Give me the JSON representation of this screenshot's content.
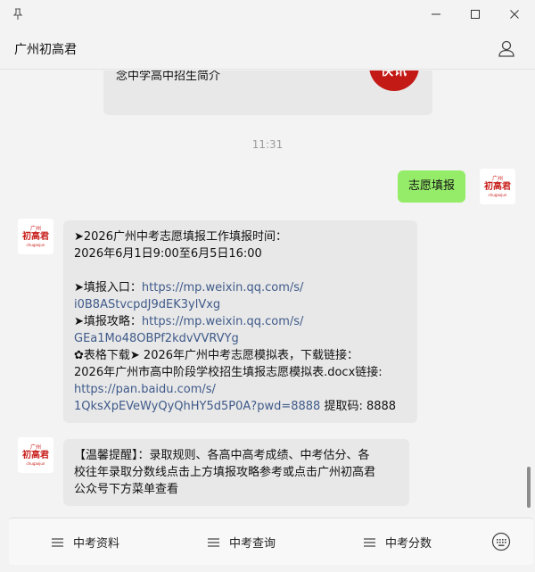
{
  "window": {
    "title": "广州初高君"
  },
  "conversation": {
    "article_card": {
      "text": "念中学高中招生简介",
      "thumb_text": "快讯"
    },
    "timestamp": "11:31",
    "sent_message": "志愿填报",
    "avatar": {
      "top": "广州",
      "main": "初高君",
      "sub": "chugaojun"
    },
    "reply1": {
      "line1": "➤2026广州中考志愿填报工作填报时间：",
      "line2": "2026年6月1日9:00至6月5日16:00",
      "entry_label": "➤填报入口：",
      "entry_url_part1": "https://mp.weixin.qq.com/s/",
      "entry_url_part2": "i0B8AStvcpdJ9dEK3ylVxg",
      "guide_label": "➤填报攻略：",
      "guide_url_part1": "https://mp.weixin.qq.com/s/",
      "guide_url_part2": "GEa1Mo48OBPf2kdvVVRVYg",
      "download_line": "✿表格下载➤ 2026年广州中考志愿模拟表，下载链接：",
      "file_line": "2026年广州市高中阶段学校招生填报志愿模拟表.docx链接:",
      "pan_url_part1": "https://pan.baidu.com/s/",
      "pan_url_part2": "1QksXpEVeWyQyQhHY5d5P0A?pwd=8888",
      "code_text": " 提取码: 8888"
    },
    "reply2": {
      "line1": "【温馨提醒】：录取规则、各高中高考成绩、中考估分、各",
      "line2": "校往年录取分数线点击上方填报攻略参考或点击广州初高君",
      "line3": "公众号下方菜单查看"
    }
  },
  "menu": {
    "items": [
      {
        "label": "中考资料",
        "icon": "hamburger-icon"
      },
      {
        "label": "中考查询",
        "icon": "hamburger-icon"
      },
      {
        "label": "中考分数",
        "icon": "hamburger-icon"
      }
    ],
    "keyboard_icon": "keyboard-icon"
  },
  "colors": {
    "sent_bubble": "#95ec69",
    "received_bubble": "#e8e8e8",
    "link": "#3f5a8a",
    "brand_red": "#c41a16"
  }
}
